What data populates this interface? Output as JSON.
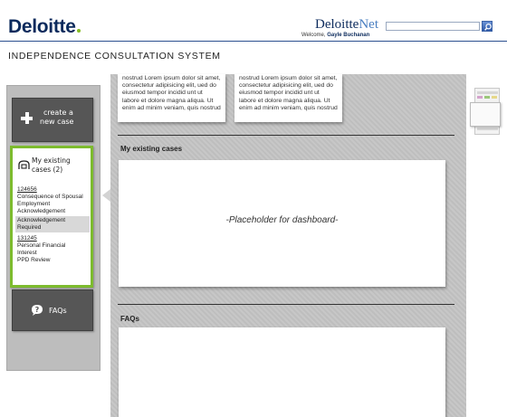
{
  "header": {
    "brand": "Deloitte",
    "brand_dot_color": "#86bc25",
    "net_brand_main": "Deloitte",
    "net_brand_suffix": "Net",
    "welcome_prefix": "Welcome,",
    "user_name": "Gayle Buchanan",
    "search_placeholder": "",
    "search_icon": "search-icon"
  },
  "page_title": "INDEPENDENCE CONSULTATION SYSTEM",
  "sidebar": {
    "create_label_line1": "create a",
    "create_label_line2": "new case",
    "create_icon": "plus-icon",
    "existing_label_line1": "My existing",
    "existing_label_line2": "cases (2)",
    "existing_icon": "cases-icon",
    "accent_color": "#7dbb2e",
    "cases": [
      {
        "number": "124656",
        "title": "Consequence of Spousal Employment Acknowledgement",
        "status": "Acknowledgement Required"
      },
      {
        "number": "131245",
        "title": "Personal Financial Interest",
        "status": "PPD Review"
      }
    ],
    "faqs_label": "FAQs",
    "faqs_icon": "question-bubble-icon"
  },
  "main": {
    "top_cards": [
      {
        "text": "nostrud Lorem ipsum dolor sit amet, consectetur adipisicing elit, ued do eiusmod tempor incidid unt ut labore et dolore magna  aliqua.  Ut enim ad minim veniam, quis nostrud"
      },
      {
        "text": "nostrud Lorem ipsum dolor sit amet, consectetur adipisicing elit, ued do eiusmod tempor incidid unt ut labore et dolore magna  aliqua.  Ut enim ad minim veniam, quis nostrud"
      }
    ],
    "existing_cases_title": "My existing cases",
    "dashboard_placeholder": "-Placeholder for dashboard-",
    "faqs_title": "FAQs"
  }
}
